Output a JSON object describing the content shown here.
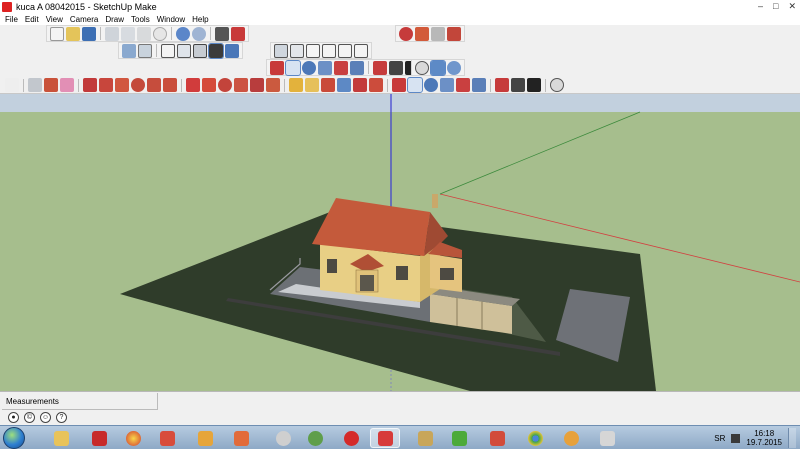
{
  "window": {
    "title": "kuca A 08042015 - SketchUp Make",
    "controls": [
      "minimize-icon",
      "maximize-icon",
      "close-icon"
    ]
  },
  "menu": [
    "File",
    "Edit",
    "View",
    "Camera",
    "Draw",
    "Tools",
    "Window",
    "Help"
  ],
  "toolbars": {
    "standard": [
      "new-icon",
      "open-icon",
      "save-icon",
      "cut-icon",
      "copy-icon",
      "paste-icon",
      "erase-icon",
      "undo-icon",
      "redo-icon",
      "print-icon",
      "model-info-icon"
    ],
    "views": [
      "iso-view-icon",
      "top-view-icon",
      "front-view-icon",
      "right-view-icon",
      "back-view-icon",
      "left-view-icon"
    ],
    "face_style": [
      "xray-icon",
      "wireframe-icon",
      "hidden-line-icon",
      "shaded-icon",
      "shaded-texture-icon",
      "monochrome-icon"
    ],
    "warehouse": [
      "3d-warehouse-icon",
      "share-model-icon",
      "share-component-icon",
      "extension-warehouse-icon"
    ],
    "camera": [
      "orbit-icon",
      "pan-icon",
      "zoom-icon",
      "zoom-window-icon",
      "zoom-extents-icon",
      "previous-view-icon",
      "position-camera-icon",
      "look-around-icon",
      "walk-icon"
    ],
    "section": [
      "section-plane-icon",
      "display-section-planes-icon",
      "display-section-cuts-icon"
    ],
    "main": [
      "select-icon",
      "make-component-icon",
      "paint-bucket-icon",
      "eraser-icon",
      "line-icon",
      "freehand-icon",
      "rectangle-icon",
      "circle-icon",
      "polygon-icon",
      "arc-icon",
      "move-icon",
      "push-pull-icon",
      "rotate-icon",
      "follow-me-icon",
      "scale-icon",
      "offset-icon",
      "tape-measure-icon",
      "dimension-icon",
      "protractor-icon",
      "text-icon",
      "axes-icon",
      "3d-text-icon",
      "orbit-icon",
      "pan-icon",
      "zoom-icon",
      "zoom-window-icon",
      "zoom-extents-icon",
      "previous-icon",
      "position-camera-icon",
      "look-around-icon",
      "walk-icon",
      "section-plane-icon"
    ]
  },
  "statusbar": {
    "measurements_label": "Measurements",
    "icons": [
      "geo-location-icon",
      "credits-icon",
      "sign-in-icon",
      "help-icon"
    ]
  },
  "taskbar": {
    "apps": [
      "windows-explorer-icon",
      "adobe-reader-icon",
      "chrome-flower-icon",
      "sketchup-layout-icon",
      "media-player-icon",
      "folder-icon",
      "disc-icon",
      "media-center-icon",
      "opera-icon",
      "sketchup-icon",
      "notepad-icon",
      "utorrent-icon",
      "ppt-icon",
      "chrome-icon",
      "avatar-icon",
      "paint-icon"
    ],
    "language": "SR",
    "time": "16:18",
    "date": "19.7.2015"
  },
  "colors": {
    "sky": "#c2d0de",
    "ground": "#a6be8d",
    "terrain": "#2f3c2a",
    "axis_blue": "#3c3cd2",
    "axis_red": "#d24040",
    "axis_green": "#3c8a3c",
    "roof": "#c45a3b",
    "wall": "#e8cf85"
  }
}
